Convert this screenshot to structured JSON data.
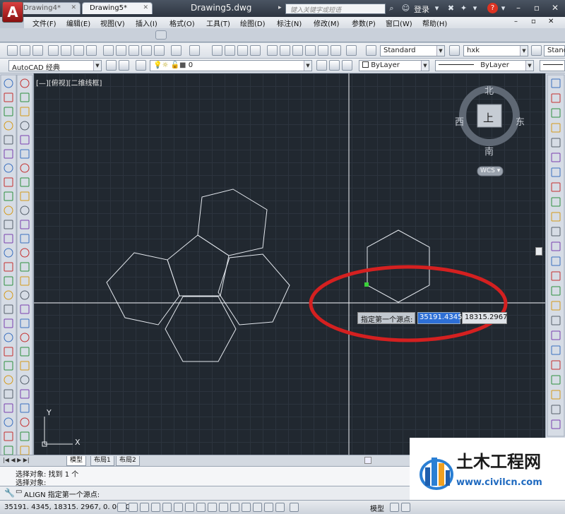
{
  "app": {
    "logo_letter": "A",
    "document_title": "Drawing5.dwg",
    "search_placeholder": "键入关键字或短语",
    "login_label": "登录",
    "help_label": "?"
  },
  "menu": [
    "文件(F)",
    "编辑(E)",
    "视图(V)",
    "插入(I)",
    "格式(O)",
    "工具(T)",
    "绘图(D)",
    "标注(N)",
    "修改(M)",
    "参数(P)",
    "窗口(W)",
    "帮助(H)"
  ],
  "tabs": [
    {
      "label": "Drawing4*",
      "close": "✕"
    },
    {
      "label": "Drawing5*",
      "close": "✕"
    }
  ],
  "toolbar": {
    "text_style": "Standard",
    "dim_style": "hxk",
    "table_style": "Stand",
    "workspace": "AutoCAD 经典",
    "layer": "0",
    "color": "ByLayer",
    "linetype": "ByLayer"
  },
  "viewport": {
    "label": "[—][俯视][二维线框]",
    "compass": {
      "north": "北",
      "south": "南",
      "east": "东",
      "west": "西",
      "top": "上"
    },
    "wcs": "WCS ▾"
  },
  "dynamic_input": {
    "prompt": "指定第一个源点:",
    "x": "35191.4345",
    "y": "18315.2967"
  },
  "ucs": {
    "x": "X",
    "y": "Y"
  },
  "layout_tabs": [
    "模型",
    "布局1",
    "布局2"
  ],
  "command": {
    "history": [
      "选择对象: 找到 1 个",
      "选择对象:"
    ],
    "current": "ALIGN 指定第一个源点:"
  },
  "status": {
    "coordinates": "35191. 4345, 18315. 2967, 0. 0000",
    "model_label": "模型"
  },
  "watermark": {
    "text": "土木工程网",
    "url": "www.civilcn.com"
  },
  "colors": {
    "canvas": "#212830",
    "highlight_ellipse": "#d42020",
    "input_highlight": "#2d6fd6"
  }
}
